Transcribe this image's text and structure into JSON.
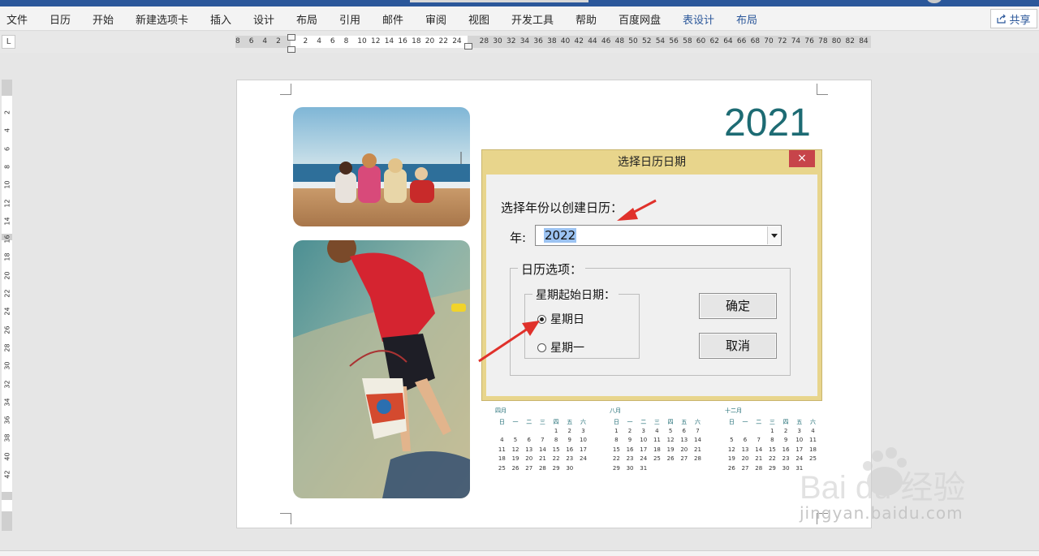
{
  "menu": {
    "items": [
      "文件",
      "日历",
      "开始",
      "新建选项卡",
      "插入",
      "设计",
      "布局",
      "引用",
      "邮件",
      "审阅",
      "视图",
      "开发工具",
      "帮助",
      "百度网盘"
    ],
    "context_items": [
      "表设计",
      "布局"
    ],
    "share_label": "共享"
  },
  "ruler": {
    "corner_symbol": "L",
    "h_ticks": [
      "8",
      "6",
      "4",
      "2",
      "",
      "2",
      "4",
      "6",
      "8",
      "10",
      "12",
      "14",
      "16",
      "18",
      "20",
      "22",
      "24",
      "",
      "28",
      "30",
      "32",
      "34",
      "36",
      "38",
      "40",
      "42",
      "44",
      "46",
      "48",
      "50",
      "52",
      "54",
      "56",
      "58",
      "60",
      "62",
      "64",
      "66",
      "68",
      "70",
      "72",
      "74",
      "76",
      "78",
      "80",
      "82",
      "84"
    ],
    "v_ticks": [
      "2",
      "4",
      "6",
      "8",
      "10",
      "12",
      "14",
      "16",
      "18",
      "20",
      "22",
      "24",
      "26",
      "28",
      "30",
      "32",
      "34",
      "36",
      "38",
      "40",
      "42"
    ]
  },
  "document": {
    "year": "2021",
    "mini_calendars": [
      {
        "month": "四月",
        "weekdays": [
          "日",
          "一",
          "二",
          "三",
          "四",
          "五",
          "六"
        ],
        "weeks": [
          [
            "",
            "",
            "",
            "",
            "1",
            "2",
            "3"
          ],
          [
            "4",
            "5",
            "6",
            "7",
            "8",
            "9",
            "10"
          ],
          [
            "11",
            "12",
            "13",
            "14",
            "15",
            "16",
            "17"
          ],
          [
            "18",
            "19",
            "20",
            "21",
            "22",
            "23",
            "24"
          ],
          [
            "25",
            "26",
            "27",
            "28",
            "29",
            "30",
            ""
          ]
        ]
      },
      {
        "month": "八月",
        "weekdays": [
          "日",
          "一",
          "二",
          "三",
          "四",
          "五",
          "六"
        ],
        "weeks": [
          [
            "1",
            "2",
            "3",
            "4",
            "5",
            "6",
            "7"
          ],
          [
            "8",
            "9",
            "10",
            "11",
            "12",
            "13",
            "14"
          ],
          [
            "15",
            "16",
            "17",
            "18",
            "19",
            "20",
            "21"
          ],
          [
            "22",
            "23",
            "24",
            "25",
            "26",
            "27",
            "28"
          ],
          [
            "29",
            "30",
            "31",
            "",
            "",
            "",
            ""
          ]
        ]
      },
      {
        "month": "十二月",
        "weekdays": [
          "日",
          "一",
          "二",
          "三",
          "四",
          "五",
          "六"
        ],
        "weeks": [
          [
            "",
            "",
            "",
            "1",
            "2",
            "3",
            "4"
          ],
          [
            "5",
            "6",
            "7",
            "8",
            "9",
            "10",
            "11"
          ],
          [
            "12",
            "13",
            "14",
            "15",
            "16",
            "17",
            "18"
          ],
          [
            "19",
            "20",
            "21",
            "22",
            "23",
            "24",
            "25"
          ],
          [
            "26",
            "27",
            "28",
            "29",
            "30",
            "31",
            ""
          ]
        ]
      }
    ]
  },
  "dialog": {
    "title": "选择日历日期",
    "close_symbol": "×",
    "prompt": "选择年份以创建日历：",
    "year_label": "年:",
    "year_value": "2022",
    "options_legend": "日历选项：",
    "week_start_legend": "星期起始日期：",
    "radio_sunday": "星期日",
    "radio_monday": "星期一",
    "selected_week_start": "星期日",
    "ok_label": "确定",
    "cancel_label": "取消"
  },
  "watermark": {
    "logo_text": "Bai du 经验",
    "url_text": "jingyan.baidu.com"
  },
  "colors": {
    "ribbon_blue": "#2b579a",
    "dialog_title": "#e8d58c",
    "close_red": "#c7444a",
    "year_teal": "#1d6b73",
    "arrow_red": "#e0312b",
    "selection": "#9cc3f2"
  }
}
